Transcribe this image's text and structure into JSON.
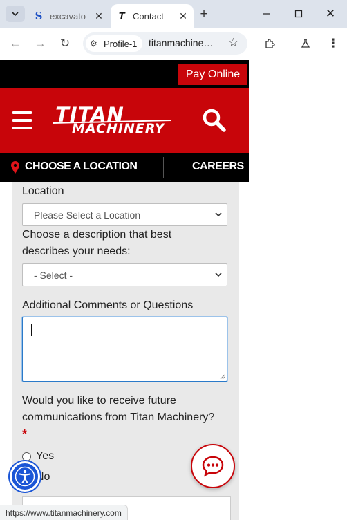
{
  "browser": {
    "tabs": [
      {
        "favicon": "S",
        "title": "excavato",
        "active": false
      },
      {
        "favicon": "T",
        "title": "Contact",
        "active": true
      }
    ],
    "profile_chip": "Profile-1",
    "url": "titanmachine…",
    "status_url": "https://www.titanmachinery.com"
  },
  "header": {
    "pay_online": "Pay Online",
    "logo_line1": "TITAN",
    "logo_line2": "MACHINERY",
    "choose_location": "CHOOSE A LOCATION",
    "careers": "CAREERS"
  },
  "form": {
    "location_label": "Location",
    "location_placeholder": "Please Select a Location",
    "needs_label_line1": "Choose a description that best",
    "needs_label_line2": "describes your needs:",
    "needs_placeholder": "- Select -",
    "comments_label": "Additional Comments or Questions",
    "comments_value": "",
    "comms_label_line1": "Would you like to receive future",
    "comms_label_line2": "communications from Titan Machinery?",
    "required_mark": "*",
    "option_yes": "Yes",
    "option_no": "No"
  },
  "colors": {
    "brand_red": "#c8050a",
    "accessibility_blue": "#1b56d6"
  }
}
